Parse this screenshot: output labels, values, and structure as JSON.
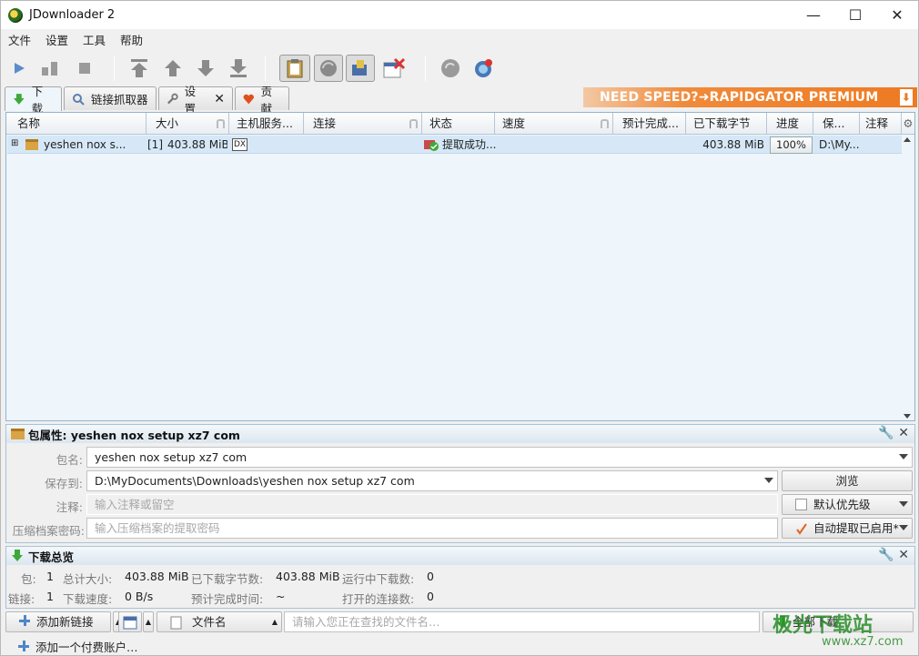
{
  "window": {
    "title": "JDownloader 2",
    "minimize": "—",
    "maximize": "☐",
    "close": "✕"
  },
  "menu": [
    "文件",
    "设置",
    "工具",
    "帮助"
  ],
  "tabs": {
    "download": "下载",
    "linkgrabber": "链接抓取器",
    "settings": "设置",
    "contribute": "贡献"
  },
  "banner": {
    "text": "NEED SPEED?➜RAPIDGATOR PREMIUM"
  },
  "grid": {
    "columns": [
      "名称",
      "大小",
      "主机服务...",
      "连接",
      "状态",
      "速度",
      "预计完成...",
      "已下载字节",
      "进度",
      "保...",
      "注释"
    ],
    "rows": [
      {
        "name": "yeshen nox s...",
        "count": "[1]",
        "size": "403.88 MiB",
        "host": "DX",
        "status": "提取成功...",
        "downloaded": "403.88 MiB",
        "progress": "100%",
        "save": "D:\\My..."
      }
    ]
  },
  "package_panel": {
    "title": "包属性: yeshen nox setup xz7 com",
    "name_label": "包名:",
    "name_value": "yeshen nox setup xz7 com",
    "save_label": "保存到:",
    "save_value": "D:\\MyDocuments\\Downloads\\yeshen nox setup xz7 com",
    "browse": "浏览",
    "comment_label": "注释:",
    "comment_placeholder": "输入注释或留空",
    "priority": "默认优先级",
    "password_label": "压缩档案密码:",
    "password_placeholder": "输入压缩档案的提取密码",
    "extract": "自动提取已启用*"
  },
  "overview": {
    "title": "下载总览",
    "packages_label": "包:",
    "packages_value": "1",
    "total_size_label": "总计大小:",
    "total_size_value": "403.88 MiB",
    "downloaded_label": "已下载字节数:",
    "downloaded_value": "403.88 MiB",
    "running_label": "运行中下载数:",
    "running_value": "0",
    "links_label": "链接:",
    "links_value": "1",
    "speed_label": "下载速度:",
    "speed_value": "0 B/s",
    "eta_label": "预计完成时间:",
    "eta_value": "~",
    "connections_label": "打开的连接数:",
    "connections_value": "0"
  },
  "bottom": {
    "add_links": "添加新链接",
    "file_name": "文件名",
    "search_placeholder": "请输入您正在查找的文件名…",
    "start_all": "全部下载"
  },
  "status": {
    "add_account": "添加一个付费账户…"
  },
  "watermark": {
    "text1": "极光下载站",
    "text2": "www.xz7.com"
  }
}
